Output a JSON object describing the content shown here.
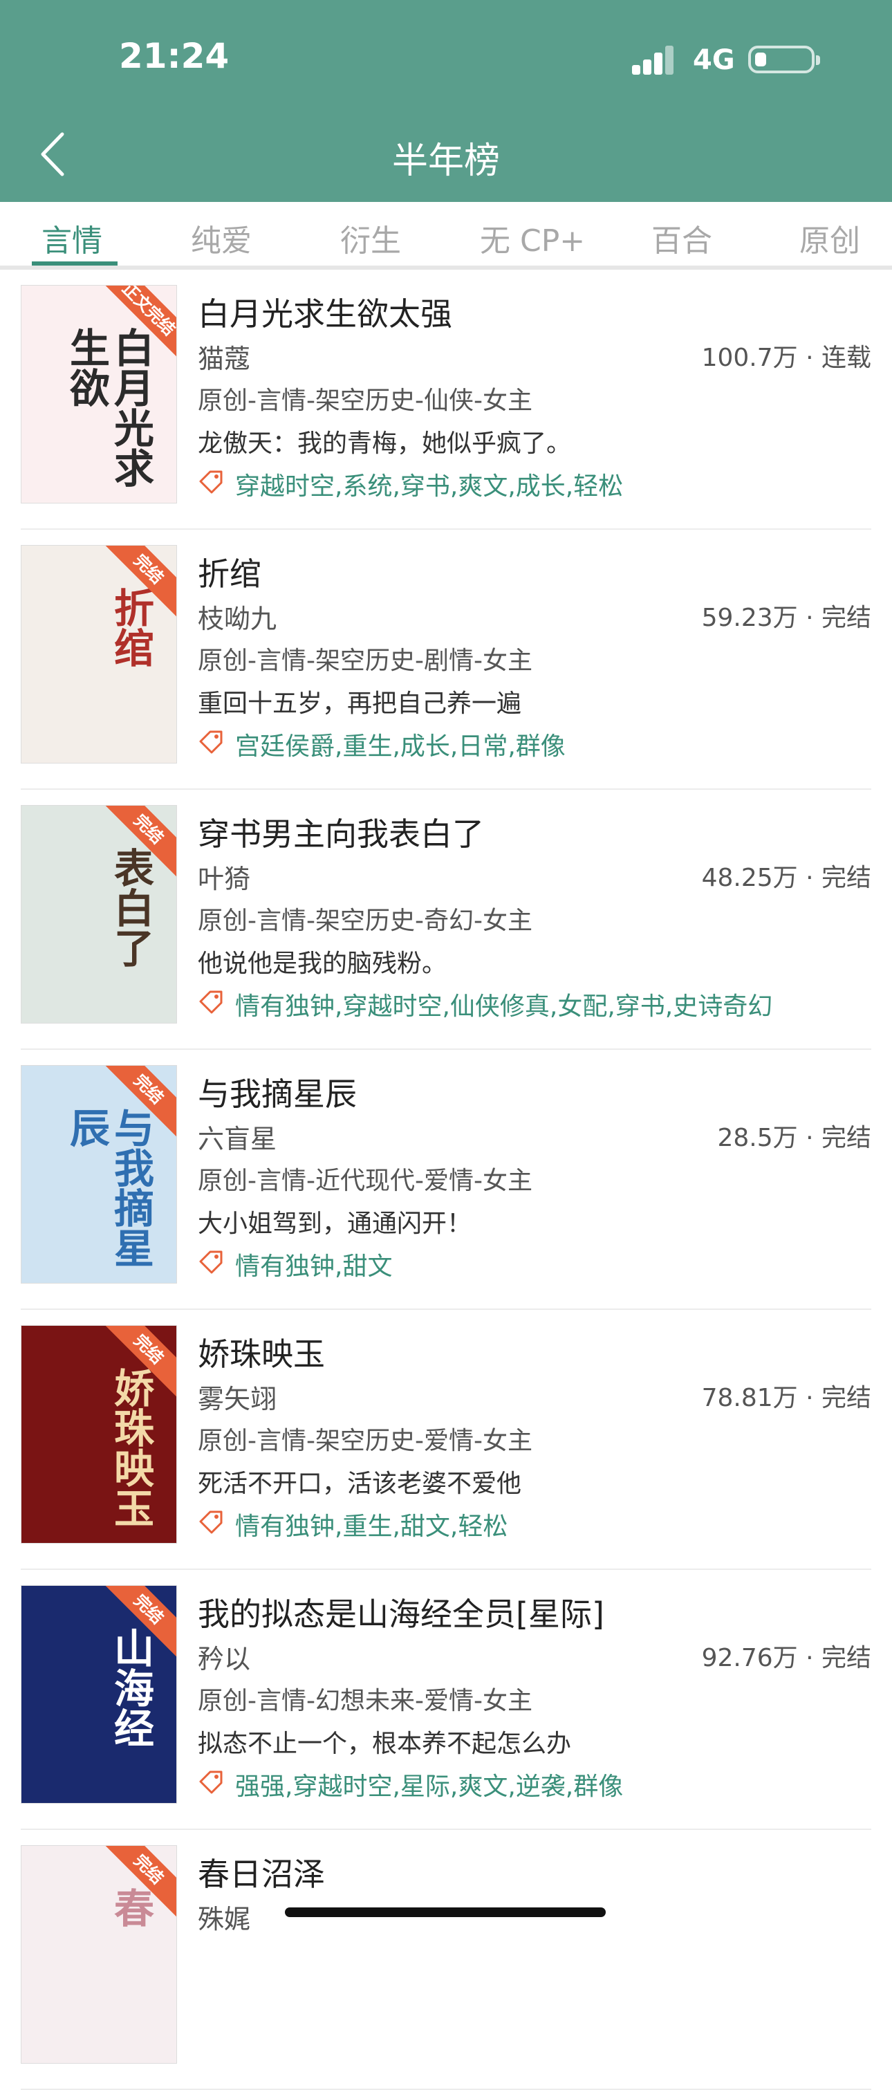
{
  "status_bar": {
    "time": "21:24",
    "network": "4G"
  },
  "nav": {
    "title": "半年榜"
  },
  "tabs": [
    {
      "label": "言情",
      "active": true
    },
    {
      "label": "纯爱",
      "active": false
    },
    {
      "label": "衍生",
      "active": false
    },
    {
      "label": "无 CP+",
      "active": false
    },
    {
      "label": "百合",
      "active": false
    },
    {
      "label": "原创",
      "active": false
    }
  ],
  "colors": {
    "header": "#5a9e8c",
    "accent": "#3a8f7a",
    "stamp": "#e8623a"
  },
  "books": [
    {
      "title": "白月光求生欲太强",
      "author": "猫蔻",
      "stats": "100.7万 · 连载",
      "genre": "原创-言情-架空历史-仙侠-女主",
      "desc": "龙傲天：我的青梅，她似乎疯了。",
      "tags": "穿越时空,系统,穿书,爽文,成长,轻松",
      "cover": {
        "stamp": "正文完结",
        "title": "白月光求生欲",
        "bg": "#fbeff0",
        "fg": "#2b2b2b"
      }
    },
    {
      "title": "折绾",
      "author": "枝呦九",
      "stats": "59.23万 · 完结",
      "genre": "原创-言情-架空历史-剧情-女主",
      "desc": "重回十五岁，再把自己养一遍",
      "tags": "宫廷侯爵,重生,成长,日常,群像",
      "cover": {
        "stamp": "完结",
        "title": "折绾",
        "bg": "#f3eee9",
        "fg": "#b0302a"
      }
    },
    {
      "title": "穿书男主向我表白了",
      "author": "叶猗",
      "stats": "48.25万 · 完结",
      "genre": "原创-言情-架空历史-奇幻-女主",
      "desc": "他说他是我的脑残粉。",
      "tags": "情有独钟,穿越时空,仙侠修真,女配,穿书,史诗奇幻",
      "cover": {
        "stamp": "完结",
        "title": "表白了",
        "bg": "#dfe7e2",
        "fg": "#4a3526"
      }
    },
    {
      "title": "与我摘星辰",
      "author": "六盲星",
      "stats": "28.5万 · 完结",
      "genre": "原创-言情-近代现代-爱情-女主",
      "desc": "大小姐驾到，通通闪开！",
      "tags": "情有独钟,甜文",
      "cover": {
        "stamp": "完结",
        "title": "与我摘星辰",
        "bg": "#cfe3f2",
        "fg": "#2f6fb1"
      }
    },
    {
      "title": "娇珠映玉",
      "author": "雾矢翊",
      "stats": "78.81万 · 完结",
      "genre": "原创-言情-架空历史-爱情-女主",
      "desc": "死活不开口，活该老婆不爱他",
      "tags": "情有独钟,重生,甜文,轻松",
      "cover": {
        "stamp": "完结",
        "title": "娇珠映玉",
        "bg": "#7a1414",
        "fg": "#f3d9a8"
      }
    },
    {
      "title": "我的拟态是山海经全员[星际]",
      "author": "矜以",
      "stats": "92.76万 · 完结",
      "genre": "原创-言情-幻想未来-爱情-女主",
      "desc": "拟态不止一个，根本养不起怎么办",
      "tags": "强强,穿越时空,星际,爽文,逆袭,群像",
      "cover": {
        "stamp": "完结",
        "title": "山海经",
        "bg": "#1a2a6e",
        "fg": "#ffffff"
      }
    },
    {
      "title": "春日沼泽",
      "author": "殊娓",
      "stats": "",
      "genre": "",
      "desc": "",
      "tags": "",
      "cover": {
        "stamp": "完结",
        "title": "春",
        "bg": "#f6eef0",
        "fg": "#c98a96"
      }
    }
  ]
}
